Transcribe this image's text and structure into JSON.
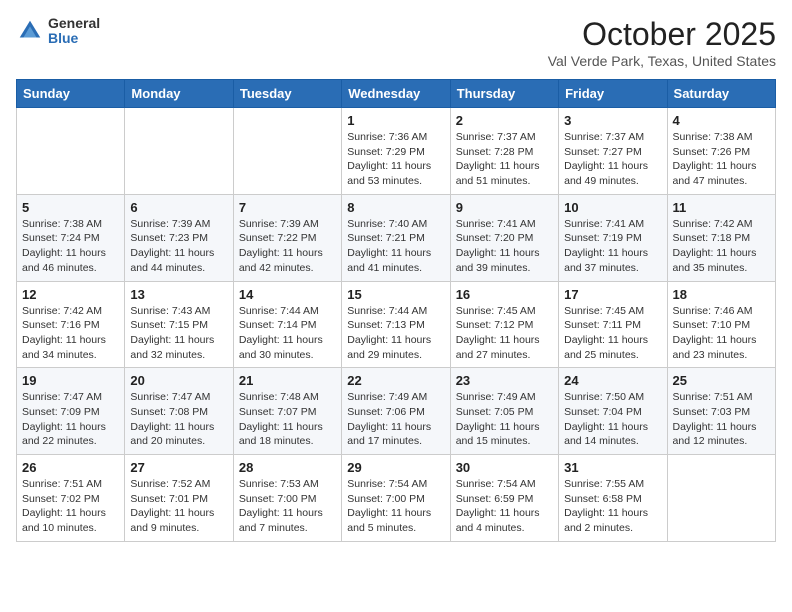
{
  "header": {
    "logo_general": "General",
    "logo_blue": "Blue",
    "month_title": "October 2025",
    "location": "Val Verde Park, Texas, United States"
  },
  "days_of_week": [
    "Sunday",
    "Monday",
    "Tuesday",
    "Wednesday",
    "Thursday",
    "Friday",
    "Saturday"
  ],
  "weeks": [
    [
      {
        "day": "",
        "info": ""
      },
      {
        "day": "",
        "info": ""
      },
      {
        "day": "",
        "info": ""
      },
      {
        "day": "1",
        "info": "Sunrise: 7:36 AM\nSunset: 7:29 PM\nDaylight: 11 hours and 53 minutes."
      },
      {
        "day": "2",
        "info": "Sunrise: 7:37 AM\nSunset: 7:28 PM\nDaylight: 11 hours and 51 minutes."
      },
      {
        "day": "3",
        "info": "Sunrise: 7:37 AM\nSunset: 7:27 PM\nDaylight: 11 hours and 49 minutes."
      },
      {
        "day": "4",
        "info": "Sunrise: 7:38 AM\nSunset: 7:26 PM\nDaylight: 11 hours and 47 minutes."
      }
    ],
    [
      {
        "day": "5",
        "info": "Sunrise: 7:38 AM\nSunset: 7:24 PM\nDaylight: 11 hours and 46 minutes."
      },
      {
        "day": "6",
        "info": "Sunrise: 7:39 AM\nSunset: 7:23 PM\nDaylight: 11 hours and 44 minutes."
      },
      {
        "day": "7",
        "info": "Sunrise: 7:39 AM\nSunset: 7:22 PM\nDaylight: 11 hours and 42 minutes."
      },
      {
        "day": "8",
        "info": "Sunrise: 7:40 AM\nSunset: 7:21 PM\nDaylight: 11 hours and 41 minutes."
      },
      {
        "day": "9",
        "info": "Sunrise: 7:41 AM\nSunset: 7:20 PM\nDaylight: 11 hours and 39 minutes."
      },
      {
        "day": "10",
        "info": "Sunrise: 7:41 AM\nSunset: 7:19 PM\nDaylight: 11 hours and 37 minutes."
      },
      {
        "day": "11",
        "info": "Sunrise: 7:42 AM\nSunset: 7:18 PM\nDaylight: 11 hours and 35 minutes."
      }
    ],
    [
      {
        "day": "12",
        "info": "Sunrise: 7:42 AM\nSunset: 7:16 PM\nDaylight: 11 hours and 34 minutes."
      },
      {
        "day": "13",
        "info": "Sunrise: 7:43 AM\nSunset: 7:15 PM\nDaylight: 11 hours and 32 minutes."
      },
      {
        "day": "14",
        "info": "Sunrise: 7:44 AM\nSunset: 7:14 PM\nDaylight: 11 hours and 30 minutes."
      },
      {
        "day": "15",
        "info": "Sunrise: 7:44 AM\nSunset: 7:13 PM\nDaylight: 11 hours and 29 minutes."
      },
      {
        "day": "16",
        "info": "Sunrise: 7:45 AM\nSunset: 7:12 PM\nDaylight: 11 hours and 27 minutes."
      },
      {
        "day": "17",
        "info": "Sunrise: 7:45 AM\nSunset: 7:11 PM\nDaylight: 11 hours and 25 minutes."
      },
      {
        "day": "18",
        "info": "Sunrise: 7:46 AM\nSunset: 7:10 PM\nDaylight: 11 hours and 23 minutes."
      }
    ],
    [
      {
        "day": "19",
        "info": "Sunrise: 7:47 AM\nSunset: 7:09 PM\nDaylight: 11 hours and 22 minutes."
      },
      {
        "day": "20",
        "info": "Sunrise: 7:47 AM\nSunset: 7:08 PM\nDaylight: 11 hours and 20 minutes."
      },
      {
        "day": "21",
        "info": "Sunrise: 7:48 AM\nSunset: 7:07 PM\nDaylight: 11 hours and 18 minutes."
      },
      {
        "day": "22",
        "info": "Sunrise: 7:49 AM\nSunset: 7:06 PM\nDaylight: 11 hours and 17 minutes."
      },
      {
        "day": "23",
        "info": "Sunrise: 7:49 AM\nSunset: 7:05 PM\nDaylight: 11 hours and 15 minutes."
      },
      {
        "day": "24",
        "info": "Sunrise: 7:50 AM\nSunset: 7:04 PM\nDaylight: 11 hours and 14 minutes."
      },
      {
        "day": "25",
        "info": "Sunrise: 7:51 AM\nSunset: 7:03 PM\nDaylight: 11 hours and 12 minutes."
      }
    ],
    [
      {
        "day": "26",
        "info": "Sunrise: 7:51 AM\nSunset: 7:02 PM\nDaylight: 11 hours and 10 minutes."
      },
      {
        "day": "27",
        "info": "Sunrise: 7:52 AM\nSunset: 7:01 PM\nDaylight: 11 hours and 9 minutes."
      },
      {
        "day": "28",
        "info": "Sunrise: 7:53 AM\nSunset: 7:00 PM\nDaylight: 11 hours and 7 minutes."
      },
      {
        "day": "29",
        "info": "Sunrise: 7:54 AM\nSunset: 7:00 PM\nDaylight: 11 hours and 5 minutes."
      },
      {
        "day": "30",
        "info": "Sunrise: 7:54 AM\nSunset: 6:59 PM\nDaylight: 11 hours and 4 minutes."
      },
      {
        "day": "31",
        "info": "Sunrise: 7:55 AM\nSunset: 6:58 PM\nDaylight: 11 hours and 2 minutes."
      },
      {
        "day": "",
        "info": ""
      }
    ]
  ]
}
